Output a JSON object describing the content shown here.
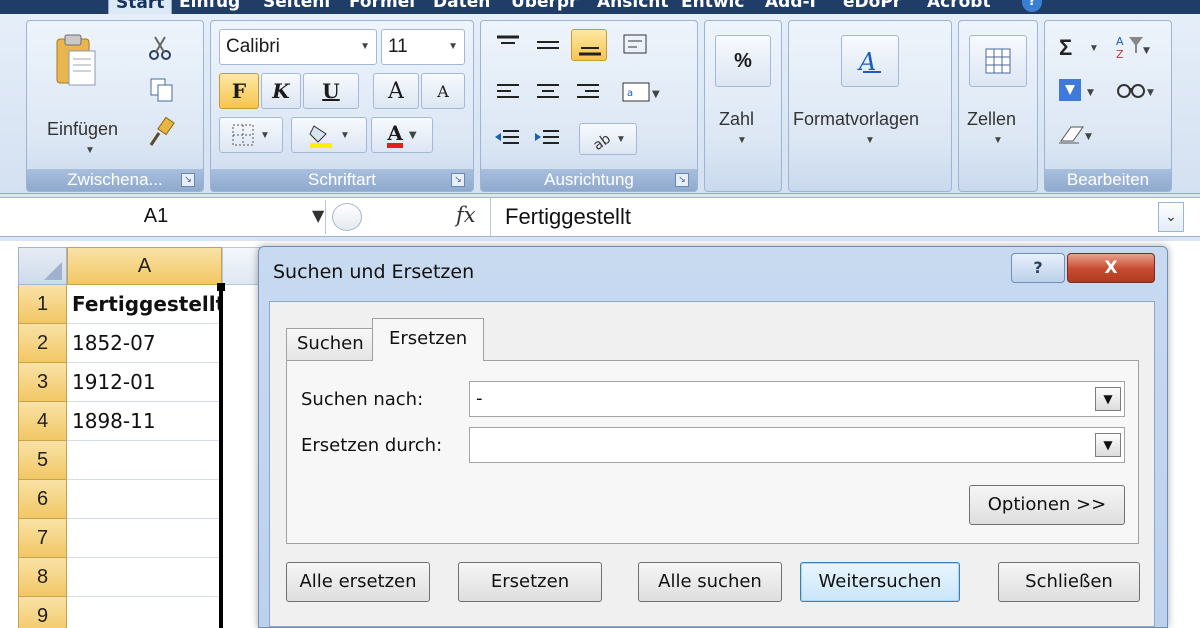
{
  "ribbon": {
    "tabs": [
      "Start",
      "Einfüg",
      "Seitenl",
      "Formel",
      "Daten",
      "Überpr",
      "Ansicht",
      "Entwic",
      "Add-I",
      "eDoPr",
      "Acrobt"
    ],
    "active_tab": "Start",
    "clipboard": {
      "paste_label": "Einfügen",
      "group_label": "Zwischena..."
    },
    "font": {
      "name": "Calibri",
      "size": "11",
      "bold": "F",
      "italic": "K",
      "underline": "U",
      "grow": "A",
      "shrink": "A",
      "fill_color": "A",
      "group_label": "Schriftart"
    },
    "alignment": {
      "group_label": "Ausrichtung"
    },
    "number": {
      "label": "Zahl",
      "icon_text": "%"
    },
    "styles": {
      "label": "Formatvorlagen"
    },
    "cells": {
      "label": "Zellen"
    },
    "editing": {
      "sigma": "Σ",
      "group_label": "Bearbeiten"
    }
  },
  "formula_bar": {
    "name_box": "A1",
    "fx": "fx",
    "value": "Fertiggestellt"
  },
  "sheet": {
    "column_header": "A",
    "rows": [
      {
        "num": "1",
        "value": "Fertiggestellt",
        "bold": true
      },
      {
        "num": "2",
        "value": "1852-07"
      },
      {
        "num": "3",
        "value": "1912-01"
      },
      {
        "num": "4",
        "value": "1898-11"
      },
      {
        "num": "5",
        "value": ""
      },
      {
        "num": "6",
        "value": ""
      },
      {
        "num": "7",
        "value": ""
      },
      {
        "num": "8",
        "value": ""
      },
      {
        "num": "9",
        "value": ""
      }
    ]
  },
  "dialog": {
    "title": "Suchen und Ersetzen",
    "help": "?",
    "close": "X",
    "tabs": [
      {
        "label": "Suchen",
        "active": false
      },
      {
        "label": "Ersetzen",
        "active": true
      }
    ],
    "find_label": "Suchen nach:",
    "find_value": "-",
    "replace_label": "Ersetzen durch:",
    "replace_value": "",
    "options_button": "Optionen >>",
    "buttons": {
      "replace_all": "Alle ersetzen",
      "replace": "Ersetzen",
      "find_all": "Alle suchen",
      "find_next": "Weitersuchen",
      "close": "Schließen"
    }
  }
}
